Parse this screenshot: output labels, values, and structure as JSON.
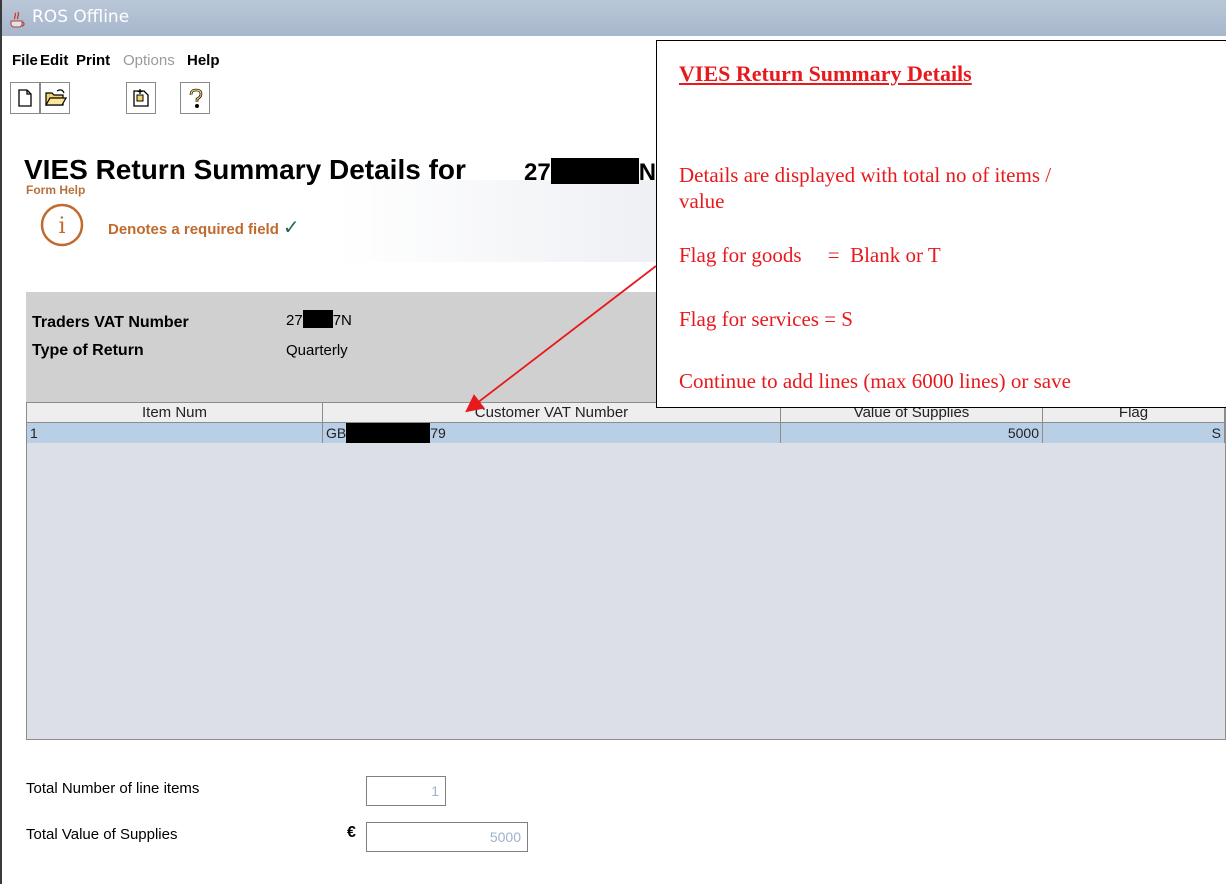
{
  "window": {
    "title": "ROS Offline"
  },
  "menu": [
    {
      "label": "File",
      "enabled": true
    },
    {
      "label": "Edit",
      "enabled": true
    },
    {
      "label": "Print",
      "enabled": true
    },
    {
      "label": "Options",
      "enabled": false
    },
    {
      "label": "Help",
      "enabled": true
    }
  ],
  "toolbar": [
    {
      "icon": "new-document-icon"
    },
    {
      "icon": "open-folder-icon"
    },
    {
      "icon": "new-return-icon"
    },
    {
      "icon": "help-icon"
    }
  ],
  "page": {
    "title": "VIES Return Summary Details for",
    "title_number_prefix": "27",
    "title_number_suffix": "N",
    "form_help": "Form Help",
    "required_note": "Denotes a required field",
    "required_tick": "✓"
  },
  "trader": {
    "vat_label": "Traders VAT Number",
    "vat_prefix": "27",
    "vat_suffix": "7N",
    "type_label": "Type of Return",
    "type_value": "Quarterly"
  },
  "table": {
    "columns": [
      "Item Num",
      "Customer VAT Number",
      "Value of Supplies",
      "Flag"
    ],
    "rows": [
      {
        "item": "1",
        "vat_prefix": "GB",
        "vat_suffix": "79",
        "value": "5000",
        "flag": "S"
      }
    ]
  },
  "totals": {
    "items_label": "Total Number of line items",
    "items_value": "1",
    "value_label": "Total Value of Supplies",
    "currency": "€",
    "value_value": "5000"
  },
  "callout": {
    "heading": "VIES Return Summary Details",
    "line1": "Details are displayed with total no of items /",
    "line2": "value",
    "line3": "Flag for goods     =  Blank or T",
    "line4": "Flag for services = S",
    "line5": "Continue to add lines (max 6000 lines) or save",
    "color": "#e8191d"
  }
}
